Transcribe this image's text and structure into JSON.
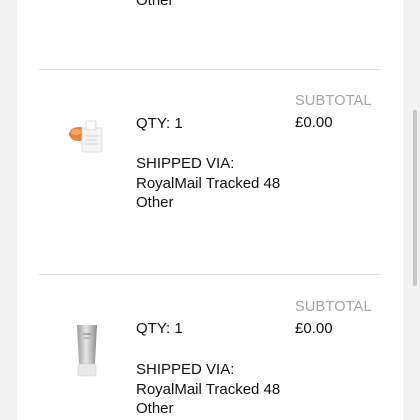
{
  "top_partial": {
    "carrier_line2": "Other"
  },
  "items": [
    {
      "qty": "QTY: 1",
      "shipped_via_label": "SHIPPED VIA:",
      "carrier_line1": "RoyalMail Tracked 48",
      "carrier_line2": "Other",
      "subtotal_label": "SUBTOTAL",
      "subtotal_value": "£0.00",
      "image": "product-sachet-thumbnail"
    },
    {
      "qty": "QTY: 1",
      "shipped_via_label": "SHIPPED VIA:",
      "carrier_line1": "RoyalMail Tracked 48",
      "carrier_line2": "Other",
      "subtotal_label": "SUBTOTAL",
      "subtotal_value": "£0.00",
      "image": "product-tube-thumbnail"
    }
  ]
}
